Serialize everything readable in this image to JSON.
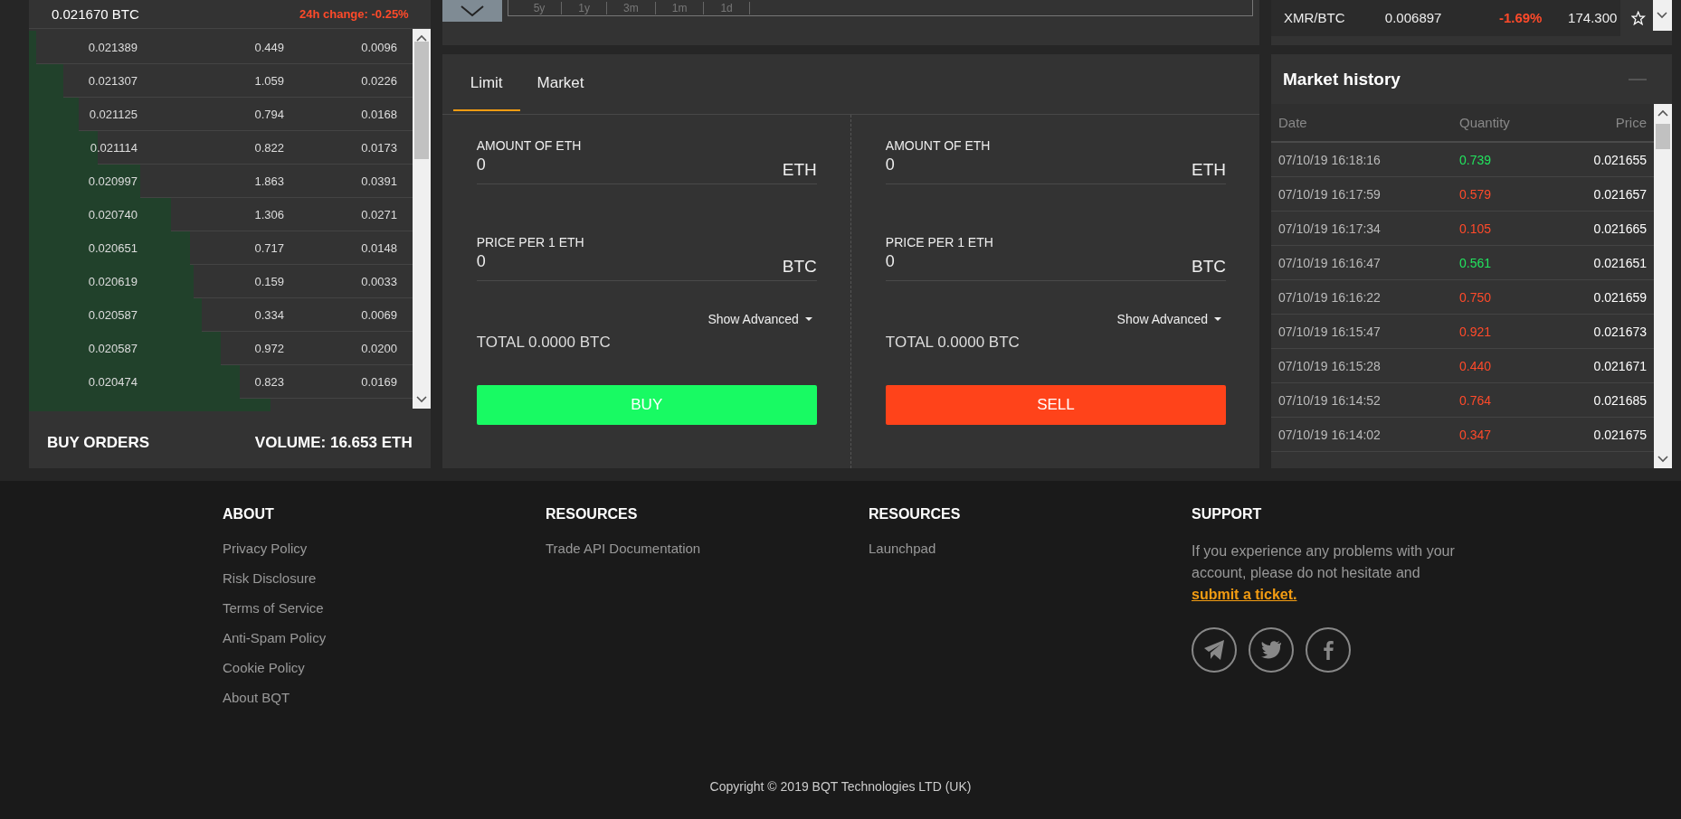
{
  "order_book": {
    "price": "0.021670 BTC",
    "change": "24h change: -0.25%",
    "rows": [
      {
        "price": "0.021389",
        "amount": "0.449",
        "total": "0.0096",
        "level": 0.02
      },
      {
        "price": "0.021307",
        "amount": "1.059",
        "total": "0.0226",
        "level": 0.09
      },
      {
        "price": "0.021125",
        "amount": "0.794",
        "total": "0.0168",
        "level": 0.13
      },
      {
        "price": "0.021114",
        "amount": "0.822",
        "total": "0.0173",
        "level": 0.18
      },
      {
        "price": "0.020997",
        "amount": "1.863",
        "total": "0.0391",
        "level": 0.29
      },
      {
        "price": "0.020740",
        "amount": "1.306",
        "total": "0.0271",
        "level": 0.37
      },
      {
        "price": "0.020651",
        "amount": "0.717",
        "total": "0.0148",
        "level": 0.42
      },
      {
        "price": "0.020619",
        "amount": "0.159",
        "total": "0.0033",
        "level": 0.43
      },
      {
        "price": "0.020587",
        "amount": "0.334",
        "total": "0.0069",
        "level": 0.45
      },
      {
        "price": "0.020587",
        "amount": "0.972",
        "total": "0.0200",
        "level": 0.5
      },
      {
        "price": "0.020474",
        "amount": "0.823",
        "total": "0.0169",
        "level": 0.55
      }
    ],
    "title": "BUY ORDERS",
    "volume": "VOLUME: 16.653 ETH"
  },
  "chart_toolbar": {
    "periods": [
      "5y",
      "1y",
      "3m",
      "1m",
      "1d"
    ]
  },
  "ticker": {
    "pair": "XMR/BTC",
    "price": "0.006897",
    "change": "-1.69%",
    "volume": "174.300",
    "favorite": false
  },
  "order_form": {
    "tabs": [
      {
        "label": "Limit",
        "selected": true
      },
      {
        "label": "Market",
        "selected": false
      }
    ],
    "sides": [
      {
        "kind": "buy",
        "amount_label": "AMOUNT OF ETH",
        "amount_value": "0",
        "amount_unit": "ETH",
        "price_label": "PRICE PER 1 ETH",
        "price_value": "0",
        "price_unit": "BTC",
        "advanced": "Show Advanced",
        "total": "TOTAL 0.0000 BTC",
        "button": "BUY"
      },
      {
        "kind": "sell",
        "amount_label": "AMOUNT OF ETH",
        "amount_value": "0",
        "amount_unit": "ETH",
        "price_label": "PRICE PER 1 ETH",
        "price_value": "0",
        "price_unit": "BTC",
        "advanced": "Show Advanced",
        "total": "TOTAL 0.0000 BTC",
        "button": "SELL"
      }
    ]
  },
  "market_history": {
    "title": "Market history",
    "columns": [
      "Date",
      "Quantity",
      "Price"
    ],
    "rows": [
      {
        "date": "07/10/19 16:18:16",
        "quantity": "0.739",
        "price": "0.021655",
        "kind": "buy"
      },
      {
        "date": "07/10/19 16:17:59",
        "quantity": "0.579",
        "price": "0.021657",
        "kind": "sell"
      },
      {
        "date": "07/10/19 16:17:34",
        "quantity": "0.105",
        "price": "0.021665",
        "kind": "sell"
      },
      {
        "date": "07/10/19 16:16:47",
        "quantity": "0.561",
        "price": "0.021651",
        "kind": "buy"
      },
      {
        "date": "07/10/19 16:16:22",
        "quantity": "0.750",
        "price": "0.021659",
        "kind": "sell"
      },
      {
        "date": "07/10/19 16:15:47",
        "quantity": "0.921",
        "price": "0.021673",
        "kind": "sell"
      },
      {
        "date": "07/10/19 16:15:28",
        "quantity": "0.440",
        "price": "0.021671",
        "kind": "sell"
      },
      {
        "date": "07/10/19 16:14:52",
        "quantity": "0.764",
        "price": "0.021685",
        "kind": "sell"
      },
      {
        "date": "07/10/19 16:14:02",
        "quantity": "0.347",
        "price": "0.021675",
        "kind": "sell"
      }
    ]
  },
  "footer": {
    "columns": [
      {
        "heading": "ABOUT",
        "links": [
          "Privacy Policy",
          "Risk Disclosure",
          "Terms of Service",
          "Anti-Spam Policy",
          "Cookie Policy",
          "About BQT"
        ]
      },
      {
        "heading": "RESOURCES",
        "links": [
          "Trade API Documentation"
        ]
      },
      {
        "heading": "RESOURCES",
        "links": [
          "Launchpad"
        ]
      }
    ],
    "support": {
      "heading": "SUPPORT",
      "text": "If you experience any problems with your account, please do not hesitate and ",
      "link": "submit a ticket."
    },
    "copyright": "Copyright © 2019 BQT Technologies LTD (UK)"
  }
}
